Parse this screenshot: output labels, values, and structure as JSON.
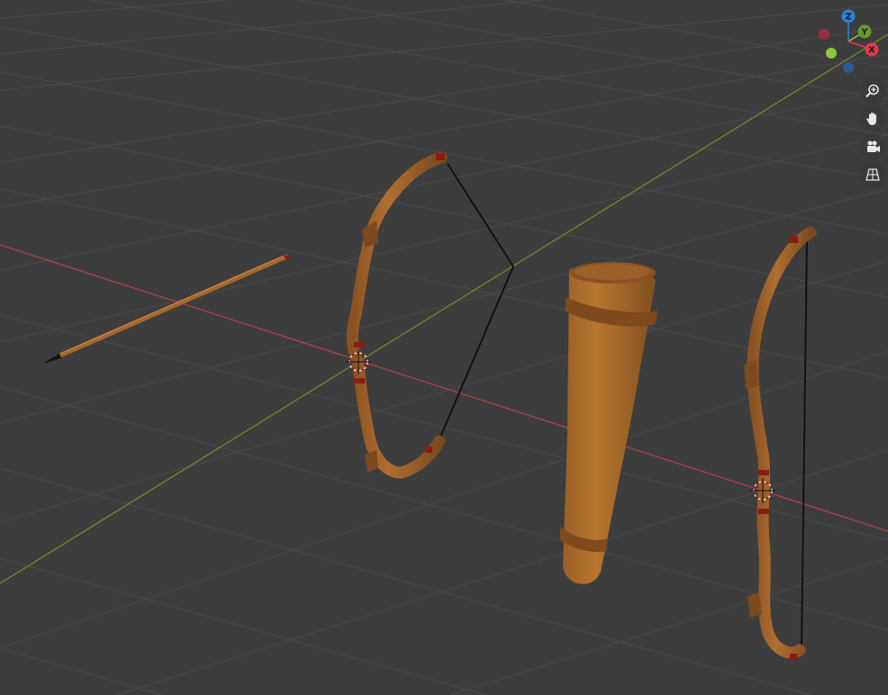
{
  "app": {
    "view": "3D Viewport"
  },
  "gizmo": {
    "z_label": "Z",
    "y_label": "Y",
    "x_label": "X",
    "colors": {
      "x": "#e8384f",
      "y": "#8ec63f",
      "z": "#2f7fd6",
      "neg_x": "#9a3045",
      "neg_y": "#6a9a2a",
      "neg_z": "#2c5a95"
    }
  },
  "navigation": {
    "zoom_icon": "zoom-in-icon",
    "pan_icon": "hand-icon",
    "camera_icon": "camera-icon",
    "ortho_icon": "grid-icon"
  },
  "scene": {
    "background": "#3d3d3d",
    "grid_color": "#4a4a4a",
    "x_axis_color": "#b0404e",
    "y_axis_color": "#6d8a2a",
    "wood_color": "#a5672d",
    "wood_dark": "#7b4a1e",
    "wrap_color": "#8a1c12",
    "objects": [
      "arrow",
      "bow-strung-curved",
      "quiver",
      "bow-strung-straight"
    ]
  }
}
